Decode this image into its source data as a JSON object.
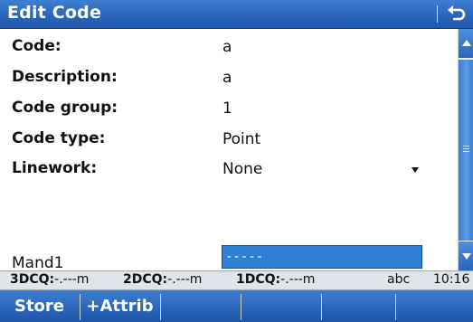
{
  "window": {
    "title": "Edit Code"
  },
  "fields": [
    {
      "label": "Code:",
      "value": "a"
    },
    {
      "label": "Description:",
      "value": "a"
    },
    {
      "label": "Code group:",
      "value": "1"
    },
    {
      "label": "Code type:",
      "value": "Point"
    },
    {
      "label": "Linework:",
      "value": "None"
    }
  ],
  "attribute": {
    "label": "Mand1",
    "value": "-----"
  },
  "status": {
    "dcq3_label": "3DCQ:",
    "dcq3_value": "-.---m",
    "dcq2_label": "2DCQ:",
    "dcq2_value": "-.---m",
    "dcq1_label": "1DCQ:",
    "dcq1_value": "-.---m",
    "input_mode": "abc",
    "time": "10:16"
  },
  "softkeys": {
    "store": "Store",
    "add_attrib": "+Attrib"
  },
  "icons": {
    "back": "back-arrow-icon",
    "dropdown": "dropdown-arrow-icon"
  },
  "colors": {
    "titlebar": "#2b66bb",
    "selected_input": "#2e7fd6",
    "statusbar": "#dfe4ea"
  }
}
